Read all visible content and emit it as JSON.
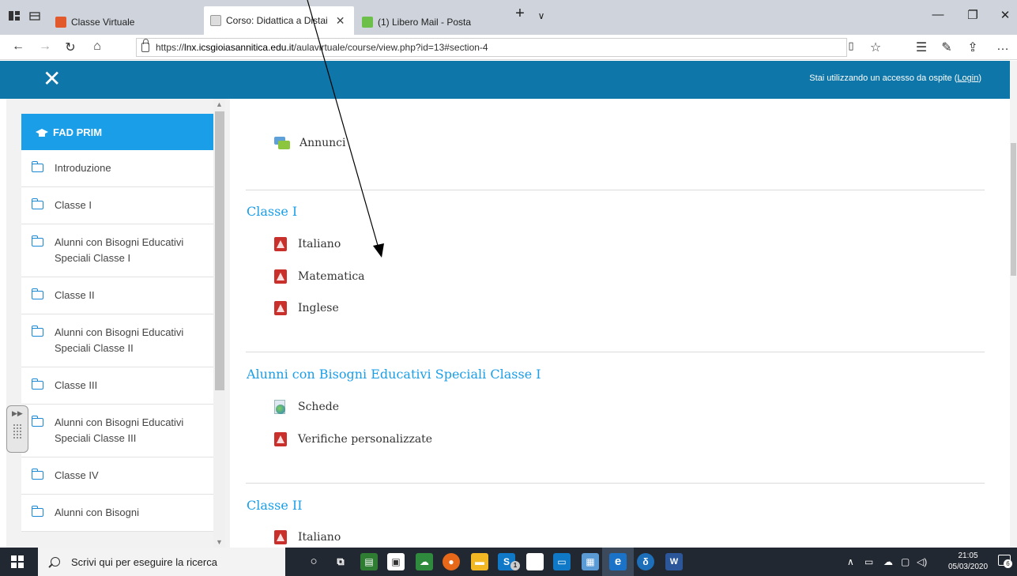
{
  "browser": {
    "tabs": [
      {
        "title": "Classe Virtuale",
        "active": false
      },
      {
        "title": "Corso: Didattica a Distai",
        "active": true
      },
      {
        "title": "(1) Libero Mail - Posta",
        "active": false
      }
    ],
    "new_tab_symbol": "+",
    "tab_list_symbol": "∨",
    "url_prefix": "https://",
    "url_host": "lnx.icsgioiasannitica.edu.it",
    "url_path": "/aulavirtuale/course/view.php?id=13#section-4",
    "window_controls": {
      "minimize": "—",
      "maximize": "❐",
      "close": "✕"
    }
  },
  "header": {
    "close_symbol": "✕",
    "login_text": "Stai utilizzando un accesso da ospite (",
    "login_link": "Login",
    "login_text_end": ")"
  },
  "sidebar": {
    "course": "FAD PRIM",
    "items": [
      {
        "label": "Introduzione"
      },
      {
        "label": "Classe I"
      },
      {
        "label": "Alunni con Bisogni Educativi Speciali Classe I"
      },
      {
        "label": "Classe II"
      },
      {
        "label": "Alunni con Bisogni Educativi Speciali Classe II"
      },
      {
        "label": "Classe III"
      },
      {
        "label": "Alunni con Bisogni Educativi Speciali Classe III"
      },
      {
        "label": "Classe IV"
      },
      {
        "label": "Alunni con Bisogni"
      }
    ]
  },
  "main": {
    "intro_activity": "Annunci",
    "sections": [
      {
        "title": "Classe I",
        "activities": [
          {
            "label": "Italiano",
            "icon": "pdf-icon"
          },
          {
            "label": "Matematica",
            "icon": "pdf-icon"
          },
          {
            "label": "Inglese",
            "icon": "pdf-icon"
          }
        ]
      },
      {
        "title": "Alunni con Bisogni Educativi Speciali Classe I",
        "activities": [
          {
            "label": "Schede",
            "icon": "url-icon"
          },
          {
            "label": "Verifiche personalizzate",
            "icon": "pdf-icon"
          }
        ]
      },
      {
        "title": "Classe II",
        "activities": [
          {
            "label": "Italiano",
            "icon": "pdf-icon"
          }
        ]
      }
    ]
  },
  "taskbar": {
    "search_placeholder": "Scrivi qui per eseguire la ricerca",
    "time": "21:05",
    "date": "05/03/2020",
    "notifications": "6",
    "skype_badge": "1"
  },
  "colors": {
    "header_blue": "#0e76a8",
    "accent_blue": "#1a9ee8",
    "pdf_red": "#c9302c",
    "taskbar": "#222831"
  }
}
